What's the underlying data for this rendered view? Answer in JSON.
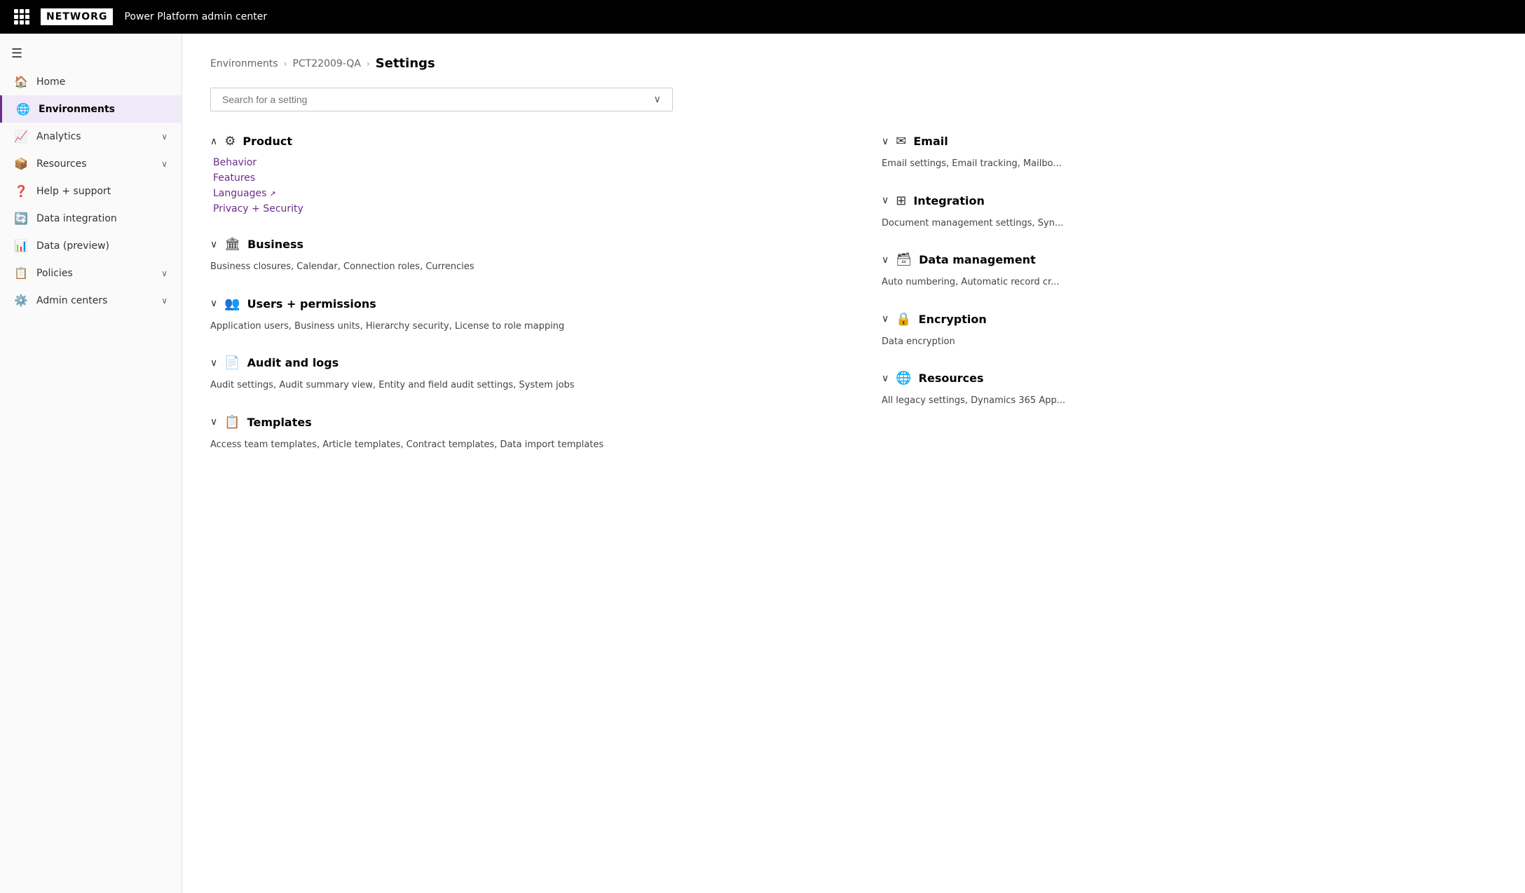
{
  "header": {
    "logo": "NETWORG",
    "title": "Power Platform admin center",
    "waffle_label": "App launcher"
  },
  "sidebar": {
    "menu_toggle": "Toggle menu",
    "items": [
      {
        "id": "home",
        "label": "Home",
        "icon": "🏠",
        "active": false,
        "expandable": false
      },
      {
        "id": "environments",
        "label": "Environments",
        "icon": "🌐",
        "active": true,
        "expandable": false
      },
      {
        "id": "analytics",
        "label": "Analytics",
        "icon": "📈",
        "active": false,
        "expandable": true
      },
      {
        "id": "resources",
        "label": "Resources",
        "icon": "📦",
        "active": false,
        "expandable": true
      },
      {
        "id": "help-support",
        "label": "Help + support",
        "icon": "❓",
        "active": false,
        "expandable": false
      },
      {
        "id": "data-integration",
        "label": "Data integration",
        "icon": "🔄",
        "active": false,
        "expandable": false
      },
      {
        "id": "data-preview",
        "label": "Data (preview)",
        "icon": "📊",
        "active": false,
        "expandable": false
      },
      {
        "id": "policies",
        "label": "Policies",
        "icon": "📋",
        "active": false,
        "expandable": true
      },
      {
        "id": "admin-centers",
        "label": "Admin centers",
        "icon": "⚙️",
        "active": false,
        "expandable": true
      }
    ]
  },
  "breadcrumb": {
    "items": [
      {
        "label": "Environments",
        "link": true
      },
      {
        "label": "PCT22009-QA",
        "link": true
      },
      {
        "label": "Settings",
        "link": false
      }
    ]
  },
  "search": {
    "placeholder": "Search for a setting"
  },
  "left_sections": [
    {
      "id": "product",
      "title": "Product",
      "icon": "⚙",
      "collapsed": false,
      "links": [
        {
          "label": "Behavior",
          "external": false
        },
        {
          "label": "Features",
          "external": false
        },
        {
          "label": "Languages",
          "external": true
        },
        {
          "label": "Privacy + Security",
          "external": false
        }
      ],
      "description": ""
    },
    {
      "id": "business",
      "title": "Business",
      "icon": "🏛",
      "collapsed": true,
      "links": [],
      "description": "Business closures, Calendar, Connection roles, Currencies"
    },
    {
      "id": "users-permissions",
      "title": "Users + permissions",
      "icon": "👥",
      "collapsed": true,
      "links": [],
      "description": "Application users, Business units, Hierarchy security, License to role mapping"
    },
    {
      "id": "audit-logs",
      "title": "Audit and logs",
      "icon": "📄",
      "collapsed": true,
      "links": [],
      "description": "Audit settings, Audit summary view, Entity and field audit settings, System jobs"
    },
    {
      "id": "templates",
      "title": "Templates",
      "icon": "📋",
      "collapsed": true,
      "links": [],
      "description": "Access team templates, Article templates, Contract templates, Data import templates"
    }
  ],
  "right_sections": [
    {
      "id": "email",
      "title": "Email",
      "icon": "✉",
      "collapsed": true,
      "description": "Email settings, Email tracking, Mailbo..."
    },
    {
      "id": "integration",
      "title": "Integration",
      "icon": "⊞",
      "collapsed": true,
      "description": "Document management settings, Syn..."
    },
    {
      "id": "data-management",
      "title": "Data management",
      "icon": "🗃",
      "collapsed": true,
      "description": "Auto numbering, Automatic record cr..."
    },
    {
      "id": "encryption",
      "title": "Encryption",
      "icon": "🔒",
      "collapsed": true,
      "description": "Data encryption"
    },
    {
      "id": "resources",
      "title": "Resources",
      "icon": "🌐",
      "collapsed": true,
      "description": "All legacy settings, Dynamics 365 App..."
    }
  ]
}
